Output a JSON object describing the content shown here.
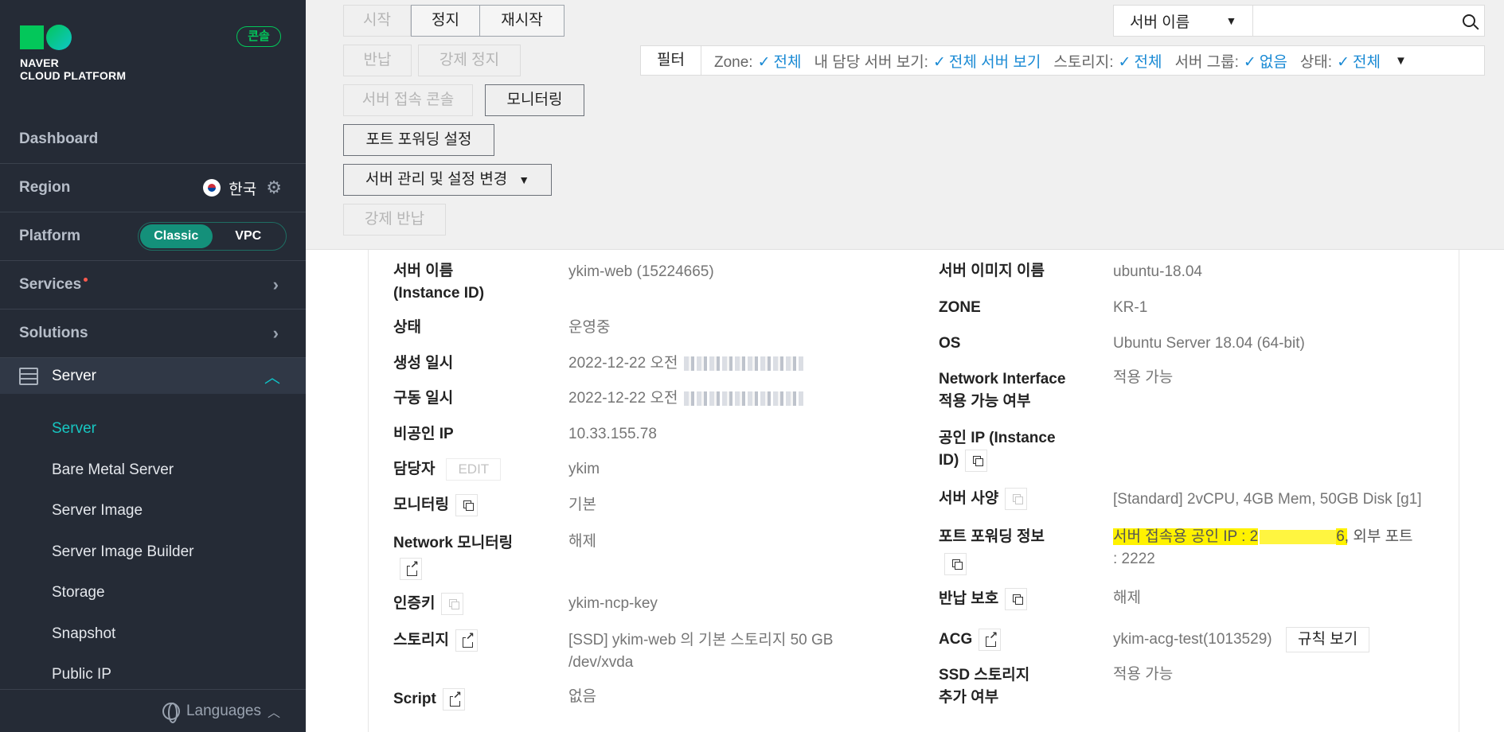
{
  "sidebar": {
    "brand": {
      "line1": "NAVER",
      "line2": "CLOUD PLATFORM"
    },
    "console_badge": "콘솔",
    "nav": {
      "dashboard": "Dashboard",
      "region": "Region",
      "region_value": "한국",
      "platform": "Platform",
      "platform_options": [
        "Classic",
        "VPC"
      ],
      "services": "Services",
      "solutions": "Solutions",
      "server": "Server"
    },
    "sub_items": [
      "Server",
      "Bare Metal Server",
      "Server Image",
      "Server Image Builder",
      "Storage",
      "Snapshot",
      "Public IP"
    ],
    "languages": "Languages"
  },
  "toolbar": {
    "start": "시작",
    "stop": "정지",
    "restart": "재시작",
    "return": "반납",
    "force_stop": "강제 정지",
    "console_access": "서버 접속 콘솔",
    "monitoring": "모니터링",
    "port_forwarding": "포트 포워딩 설정",
    "server_manage": "서버 관리 및 설정 변경",
    "force_return": "강제 반납"
  },
  "search": {
    "select_value": "서버 이름",
    "input_value": ""
  },
  "filter": {
    "title": "필터",
    "items": [
      {
        "label": "Zone:",
        "value": "전체"
      },
      {
        "label": "내 담당 서버 보기:",
        "value": "전체 서버 보기"
      },
      {
        "label": "스토리지:",
        "value": "전체"
      },
      {
        "label": "서버 그룹:",
        "value": "없음"
      },
      {
        "label": "상태:",
        "value": "전체"
      }
    ]
  },
  "detail": {
    "left": {
      "server_name_label_1": "서버 이름",
      "server_name_label_2": "(Instance ID)",
      "server_name_value": "ykim-web (15224665)",
      "status_label": "상태",
      "status_value": "운영중",
      "created_label": "생성 일시",
      "created_value": "2022-12-22 오전",
      "started_label": "구동 일시",
      "started_value": "2022-12-22 오전",
      "private_ip_label": "비공인 IP",
      "private_ip_value": "10.33.155.78",
      "owner_label": "담당자",
      "owner_edit": "EDIT",
      "owner_value": "ykim",
      "monitoring_label": "모니터링",
      "monitoring_value": "기본",
      "net_monitoring_label": "Network 모니터링",
      "net_monitoring_value": "해제",
      "auth_key_label": "인증키",
      "auth_key_value": "ykim-ncp-key",
      "storage_label": "스토리지",
      "storage_value_1": "[SSD] ykim-web 의 기본 스토리지  50 GB",
      "storage_value_2": "/dev/xvda",
      "script_label": "Script",
      "script_value": "없음"
    },
    "right": {
      "image_label": "서버 이미지 이름",
      "image_value": "ubuntu-18.04",
      "zone_label": "ZONE",
      "zone_value": "KR-1",
      "os_label": "OS",
      "os_value": "Ubuntu Server 18.04 (64-bit)",
      "ni_label_1": "Network Interface",
      "ni_label_2": "적용 가능 여부",
      "ni_value": "적용 가능",
      "public_ip_label_1": "공인 IP (Instance",
      "public_ip_label_2": "ID)",
      "spec_label": "서버 사양",
      "spec_value": "[Standard] 2vCPU, 4GB Mem, 50GB Disk [g1]",
      "port_fwd_label": "포트 포워딩 정보",
      "port_fwd_value_1a": "서버 접속용 공인 IP : 2",
      "port_fwd_value_1b": "6, 외부 포트",
      "port_fwd_value_2": ": 2222",
      "return_protect_label": "반납 보호",
      "return_protect_value": "해제",
      "acg_label": "ACG",
      "acg_value": "ykim-acg-test(1013529)",
      "acg_rule_button": "규칙 보기",
      "ssd_label_1": "SSD 스토리지",
      "ssd_label_2": "추가 여부",
      "ssd_value": "적용 가능"
    }
  },
  "colors": {
    "sidebar_bg": "#252b36",
    "accent_teal": "#14907a",
    "brand_green": "#03c75a",
    "link_blue": "#1a8ad4",
    "highlight": "#fff200"
  }
}
